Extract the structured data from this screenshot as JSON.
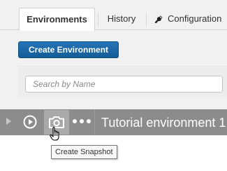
{
  "tabs": [
    {
      "label": "Environments",
      "active": true
    },
    {
      "label": "History",
      "active": false
    },
    {
      "label": "Configuration",
      "active": false,
      "icon": "wrench-icon"
    }
  ],
  "toolbar": {
    "create_label": "Create Environment"
  },
  "search": {
    "placeholder": "Search by Name",
    "value": ""
  },
  "environment_row": {
    "name": "Tutorial environment 1",
    "icons": [
      "expand-arrow-icon",
      "play-icon",
      "camera-icon",
      "more-icon"
    ]
  },
  "tooltip": {
    "text": "Create Snapshot"
  },
  "colors": {
    "header_bg": "#f1f1f1",
    "button_blue": "#1d69a8",
    "row_bg": "#8c8c8c",
    "row_hover_bg": "#a9a9a9"
  }
}
